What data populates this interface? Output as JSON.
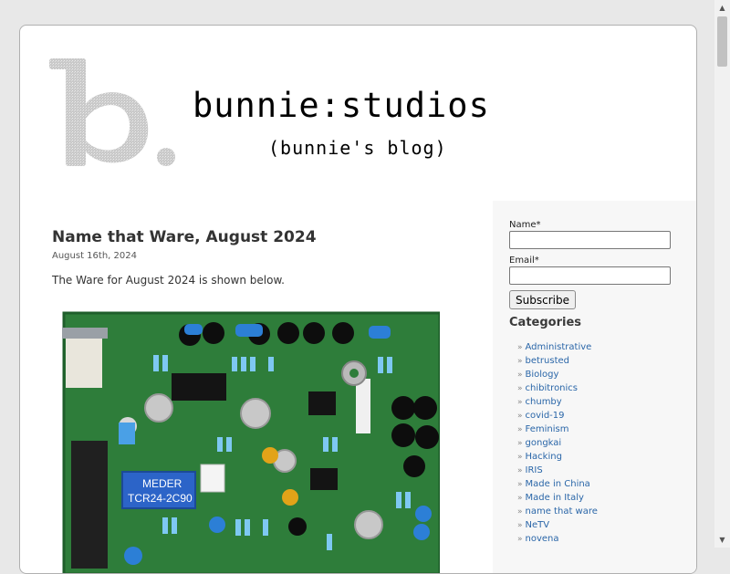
{
  "header": {
    "logo_letter": "b.",
    "site_title": "bunnie:studios",
    "site_subtitle": "(bunnie's blog)"
  },
  "post": {
    "title": "Name that Ware, August 2024",
    "date": "August 16th, 2024",
    "body": "The Ware for August 2024 is shown below.",
    "image_labels": [
      "MEDER",
      "TCR24-2C90"
    ]
  },
  "subscribe": {
    "name_label": "Name*",
    "email_label": "Email*",
    "button_label": "Subscribe"
  },
  "categories": {
    "heading": "Categories",
    "items": [
      "Administrative",
      "betrusted",
      "Biology",
      "chibitronics",
      "chumby",
      "covid-19",
      "Feminism",
      "gongkai",
      "Hacking",
      "IRIS",
      "Made in China",
      "Made in Italy",
      "name that ware",
      "NeTV",
      "novena"
    ]
  },
  "colors": {
    "background": "#e8e8e8",
    "page": "#ffffff",
    "sidebar": "#f7f7f7",
    "link": "#2a66a8",
    "pcb_green": "#2e7d3a"
  },
  "icons": {
    "scroll_up": "▲",
    "scroll_down": "▼",
    "bullet": "»"
  }
}
